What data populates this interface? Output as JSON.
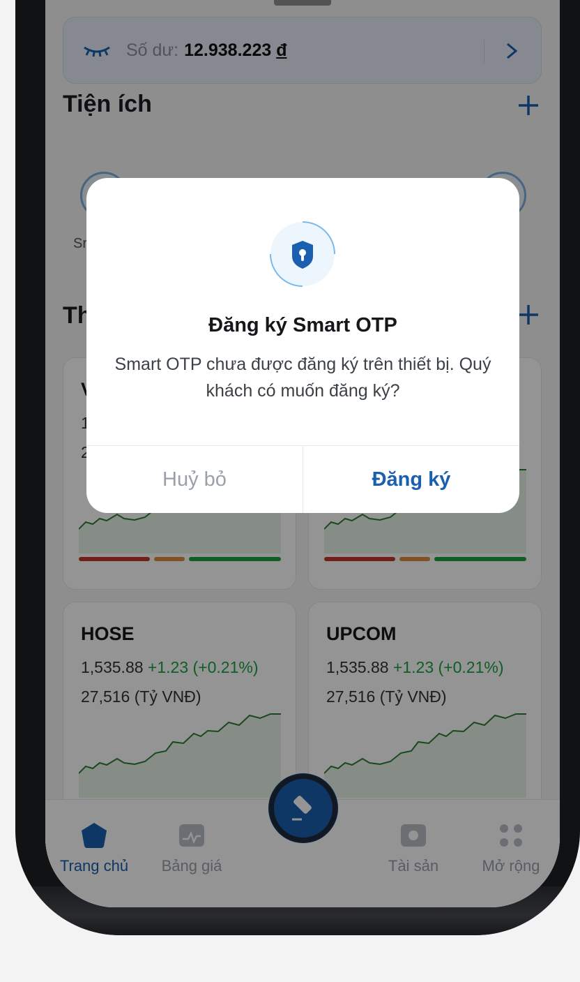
{
  "balance": {
    "label": "Số dư:",
    "amount": "12.938.223",
    "currency": "đ"
  },
  "sections": {
    "utilities_title": "Tiện ích",
    "market_title_partial": "Th",
    "util_label_partial": "Sr"
  },
  "market_cards": [
    {
      "title": "V",
      "price": "1",
      "volume": "2",
      "change": ""
    },
    {
      "title": "",
      "price": "",
      "volume": "",
      "change": ""
    },
    {
      "title": "HOSE",
      "price": "1,535.88",
      "change": "+1.23 (+0.21%)",
      "volume": "27,516 (Tỷ VNĐ)"
    },
    {
      "title": "UPCOM",
      "price": "1,535.88",
      "change": "+1.23 (+0.21%)",
      "volume": "27,516 (Tỷ VNĐ)"
    }
  ],
  "tabbar": {
    "home": "Trang chủ",
    "prices": "Bảng giá",
    "assets": "Tài sản",
    "more": "Mở rộng"
  },
  "dialog": {
    "title": "Đăng ký Smart OTP",
    "message": "Smart OTP chưa được đăng ký trên thiết bị. Quý khách có muốn đăng ký?",
    "cancel": "Huỷ bỏ",
    "confirm": "Đăng ký"
  },
  "colors": {
    "accent": "#1a5fb0",
    "positive": "#1ba33d",
    "negative": "#c0392b",
    "neutral": "#e08a3c"
  },
  "icons": [
    "eye-closed-icon",
    "chevron-right-icon",
    "plus-icon",
    "shield-keyhole-icon",
    "home-icon",
    "price-board-icon",
    "order-icon",
    "assets-icon",
    "more-grid-icon"
  ]
}
